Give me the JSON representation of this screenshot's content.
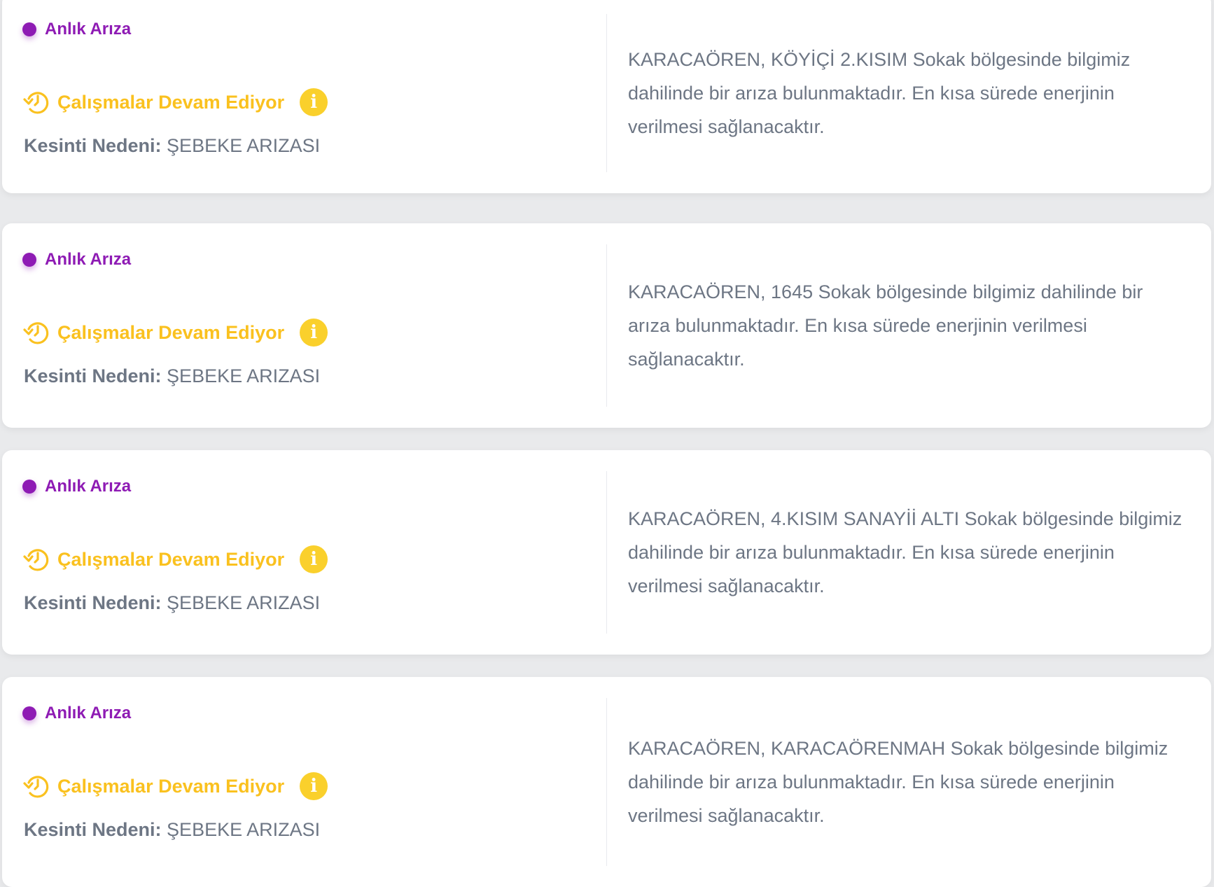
{
  "colors": {
    "type_accent": "#8e1bb4",
    "status_accent": "#fac11f",
    "text_muted": "#6d7684",
    "card_bg": "#ffffff",
    "page_bg": "#e9eaec"
  },
  "icons": {
    "status": "clock-rewind-icon",
    "info": "info-icon"
  },
  "outages": [
    {
      "type": "Anlık Arıza",
      "status": "Çalışmalar Devam Ediyor",
      "info_glyph": "i",
      "reason_label": "Kesinti Nedeni:",
      "reason_value": "ŞEBEKE ARIZASI",
      "description": "KARACAÖREN, KÖYİÇİ 2.KISIM Sokak bölgesinde bilgimiz dahilinde bir arıza bulunmaktadır. En kısa sürede enerjinin verilmesi sağlanacaktır."
    },
    {
      "type": "Anlık Arıza",
      "status": "Çalışmalar Devam Ediyor",
      "info_glyph": "i",
      "reason_label": "Kesinti Nedeni:",
      "reason_value": "ŞEBEKE ARIZASI",
      "description": "KARACAÖREN, 1645 Sokak bölgesinde bilgimiz dahilinde bir arıza bulunmaktadır. En kısa sürede enerjinin verilmesi sağlanacaktır."
    },
    {
      "type": "Anlık Arıza",
      "status": "Çalışmalar Devam Ediyor",
      "info_glyph": "i",
      "reason_label": "Kesinti Nedeni:",
      "reason_value": "ŞEBEKE ARIZASI",
      "description": "KARACAÖREN, 4.KISIM SANAYİİ ALTI Sokak bölgesinde bilgimiz dahilinde bir arıza bulunmaktadır. En kısa sürede enerjinin verilmesi sağlanacaktır."
    },
    {
      "type": "Anlık Arıza",
      "status": "Çalışmalar Devam Ediyor",
      "info_glyph": "i",
      "reason_label": "Kesinti Nedeni:",
      "reason_value": "ŞEBEKE ARIZASI",
      "description": "KARACAÖREN, KARACAÖRENMAH Sokak bölgesinde bilgimiz dahilinde bir arıza bulunmaktadır. En kısa sürede enerjinin verilmesi sağlanacaktır."
    }
  ]
}
